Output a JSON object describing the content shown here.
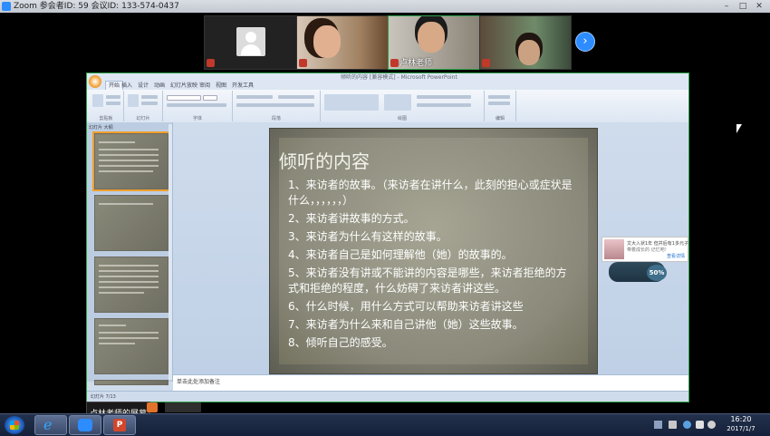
{
  "zoom": {
    "title": "Zoom 参会者ID: 59   会议ID: 133-574-0437"
  },
  "participants": [
    {
      "name": ""
    },
    {
      "name": ""
    },
    {
      "name": "卢林老师"
    },
    {
      "name": ""
    }
  ],
  "nav": {
    "next_arrow": "›"
  },
  "ppt": {
    "window_title": "倾听的内容 [兼容模式] - Microsoft PowerPoint",
    "tabs": [
      "开始",
      "插入",
      "设计",
      "动画",
      "幻灯片放映",
      "审阅",
      "视图",
      "开发工具"
    ],
    "ribbon_groups": [
      "剪贴板",
      "幻灯片",
      "字体",
      "段落",
      "绘图",
      "编辑"
    ],
    "panel_tabs": "幻灯片  大纲",
    "notes_placeholder": "单击此处添加备注",
    "status": "幻灯片 7/13"
  },
  "slide": {
    "title": "倾听的内容",
    "items": [
      "1、来访者的故事。（来访者在讲什么，此刻的担心或症状是什么，，，，，，）",
      "2、来访者讲故事的方式。",
      "3、来访者为什么有这样的故事。",
      "4、来访者自己是如何理解他（她）的故事的。",
      "5、来访者没有讲或不能讲的内容是哪些，来访者拒绝的方式和拒绝的程度，什么妨碍了来访者讲这些。",
      "6、什么时候，用什么方式可以帮助来访者讲这些",
      "7、来访者为什么来和自己讲他（她）这些故事。",
      "8、倾听自己的感受。"
    ]
  },
  "chat_popup": {
    "line1": "文大入状1年 但并后有1多元子",
    "line2": "带着成长的 记忆吧！",
    "link": "查看详情"
  },
  "network": {
    "percent": "50%"
  },
  "share_label": "卢林老师的屏幕",
  "taskbar": {
    "ie_glyph": "e",
    "ppt_glyph": "P",
    "time": "16:20",
    "date": "2017/1/7"
  },
  "colors": {
    "zoom_blue": "#2d8cff",
    "active_speaker": "#2fa14a",
    "slide_text": "#ffffff"
  }
}
